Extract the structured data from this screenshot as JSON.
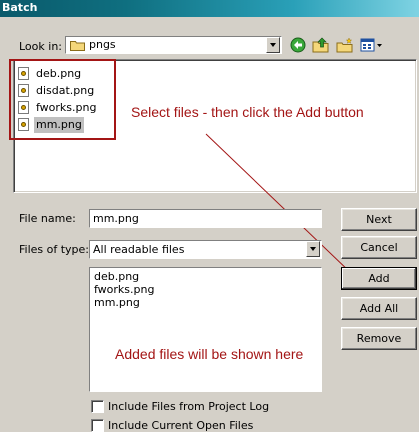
{
  "window": {
    "title": "Batch"
  },
  "lookin": {
    "label": "Look in:",
    "value": "pngs"
  },
  "files": [
    {
      "name": "deb.png"
    },
    {
      "name": "disdat.png"
    },
    {
      "name": "fworks.png"
    },
    {
      "name": "mm.png",
      "selected": true
    }
  ],
  "annotations": {
    "select": "Select files - then click the Add button",
    "added": "Added files will be shown here",
    "color": "#a31515"
  },
  "filename": {
    "label": "File name:",
    "value": "mm.png"
  },
  "filetype": {
    "label": "Files of type:",
    "value": "All readable files"
  },
  "added_list": [
    "deb.png",
    "fworks.png",
    "mm.png"
  ],
  "buttons": {
    "next": "Next",
    "cancel": "Cancel",
    "add": "Add",
    "add_all": "Add All",
    "remove": "Remove"
  },
  "checkboxes": {
    "project_log": "Include Files from Project Log",
    "open_files": "Include Current Open Files"
  },
  "icons": [
    "folder-icon",
    "back-icon",
    "up-folder-icon",
    "new-folder-icon",
    "view-menu-icon",
    "png-file-icon"
  ]
}
